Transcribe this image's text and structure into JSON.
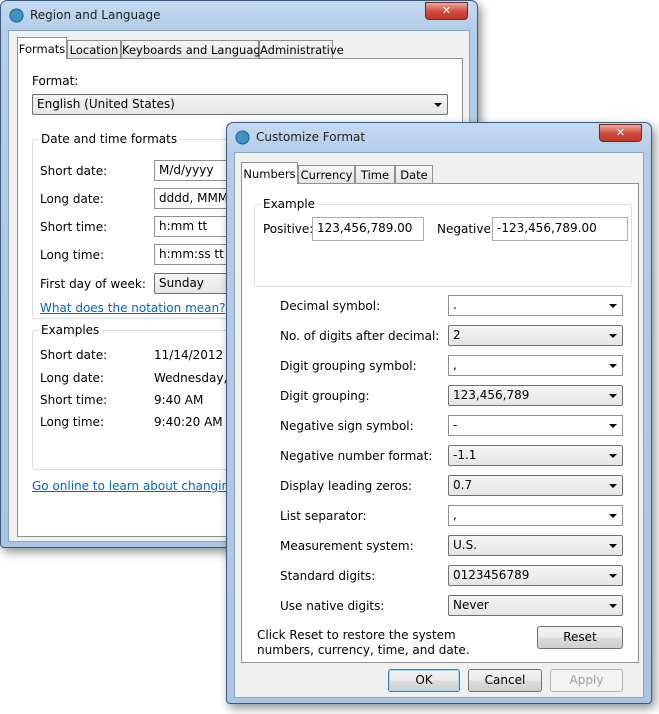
{
  "region_window": {
    "title": "Region and Language",
    "close_label": "✕",
    "tabs": [
      "Formats",
      "Location",
      "Keyboards and Languages",
      "Administrative"
    ],
    "format_label": "Format:",
    "format_value": "English (United States)",
    "dt_group_title": "Date and time formats",
    "dt_rows": [
      {
        "label": "Short date:",
        "value": "M/d/yyyy"
      },
      {
        "label": "Long date:",
        "value": "dddd, MMM"
      },
      {
        "label": "Short time:",
        "value": "h:mm tt"
      },
      {
        "label": "Long time:",
        "value": "h:mm:ss tt"
      },
      {
        "label": "First day of week:",
        "value": "Sunday"
      }
    ],
    "notation_link": "What does the notation mean?",
    "examples_title": "Examples",
    "examples": [
      {
        "label": "Short date:",
        "value": "11/14/2012"
      },
      {
        "label": "Long date:",
        "value": "Wednesday, N"
      },
      {
        "label": "Short time:",
        "value": "9:40 AM"
      },
      {
        "label": "Long time:",
        "value": "9:40:20 AM"
      }
    ],
    "online_link": "Go online to learn about changing lan"
  },
  "customize_window": {
    "title": "Customize Format",
    "close_label": "✕",
    "tabs": [
      "Numbers",
      "Currency",
      "Time",
      "Date"
    ],
    "example_title": "Example",
    "positive_label": "Positive:",
    "positive_value": "123,456,789.00",
    "negative_label": "Negative:",
    "negative_value": "-123,456,789.00",
    "settings": [
      {
        "label": "Decimal symbol:",
        "value": "."
      },
      {
        "label": "No. of digits after decimal:",
        "value": "2"
      },
      {
        "label": "Digit grouping symbol:",
        "value": ","
      },
      {
        "label": "Digit grouping:",
        "value": "123,456,789"
      },
      {
        "label": "Negative sign symbol:",
        "value": "-"
      },
      {
        "label": "Negative number format:",
        "value": "-1.1"
      },
      {
        "label": "Display leading zeros:",
        "value": "0.7"
      },
      {
        "label": "List separator:",
        "value": ","
      },
      {
        "label": "Measurement system:",
        "value": "U.S."
      },
      {
        "label": "Standard digits:",
        "value": "0123456789"
      },
      {
        "label": "Use native digits:",
        "value": "Never"
      }
    ],
    "reset_note_line1": "Click Reset to restore the system",
    "reset_note_line2": "numbers, currency, time, and date.",
    "reset_label": "Reset",
    "ok_label": "OK",
    "cancel_label": "Cancel",
    "apply_label": "Apply"
  }
}
